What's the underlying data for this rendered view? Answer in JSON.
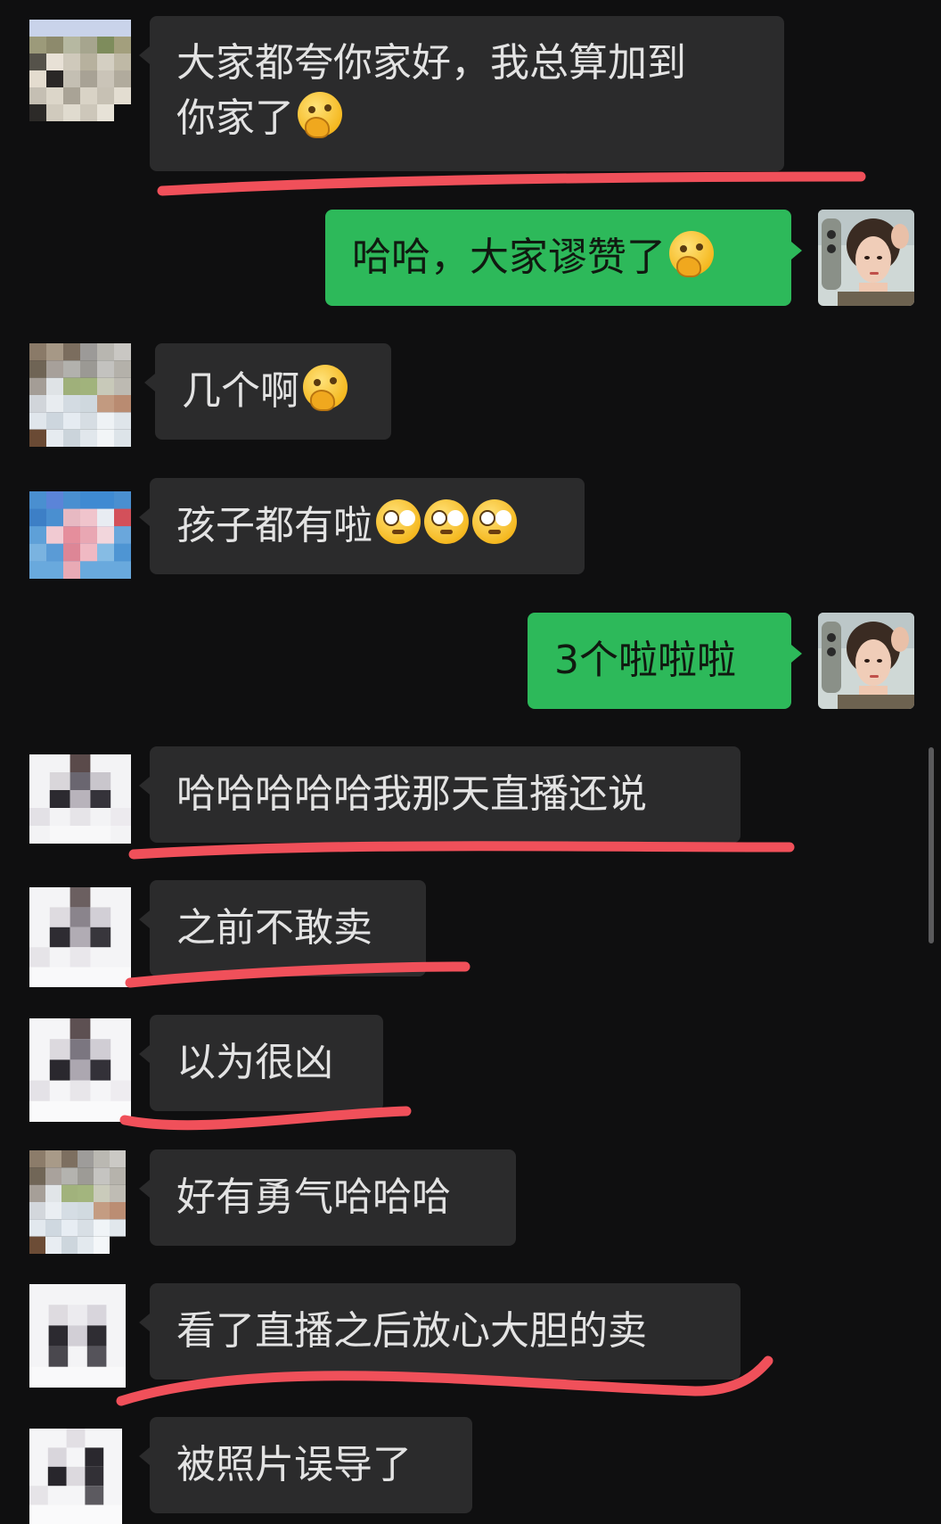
{
  "messages": [
    {
      "side": "left",
      "text": "大家都夸你家好，我总算加到\n你家了",
      "emojis": [
        "thinking-face"
      ]
    },
    {
      "side": "right",
      "text": "哈哈，大家谬赞了",
      "emojis": [
        "thinking-face"
      ]
    },
    {
      "side": "left",
      "text": "几个啊",
      "emojis": [
        "thinking-face"
      ]
    },
    {
      "side": "left",
      "text": "孩子都有啦",
      "emojis": [
        "flushed-face",
        "flushed-face",
        "flushed-face"
      ]
    },
    {
      "side": "right",
      "text": "3个啦啦啦",
      "emojis": []
    },
    {
      "side": "left",
      "text": "哈哈哈哈哈我那天直播还说",
      "emojis": []
    },
    {
      "side": "left",
      "text": "之前不敢卖",
      "emojis": []
    },
    {
      "side": "left",
      "text": "以为很凶",
      "emojis": []
    },
    {
      "side": "left",
      "text": "好有勇气哈哈哈",
      "emojis": []
    },
    {
      "side": "left",
      "text": "看了直播之后放心大胆的卖",
      "emojis": []
    },
    {
      "side": "left",
      "text": "被照片误导了",
      "emojis": []
    }
  ],
  "colors": {
    "background": "#0f0f10",
    "incoming_bubble": "#2b2b2c",
    "outgoing_bubble": "#2db95a",
    "annotation_underline": "#f0505a"
  },
  "icons": {
    "incoming_avatar": "pixelated-avatar",
    "outgoing_avatar": "profile-photo-avatar",
    "emoji_thinking": "thinking-face",
    "emoji_flushed": "flushed-face"
  }
}
